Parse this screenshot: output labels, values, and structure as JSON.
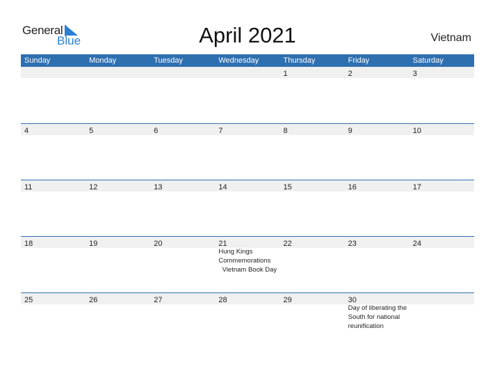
{
  "logo": {
    "line1": "General",
    "line2": "Blue"
  },
  "title": "April 2021",
  "country": "Vietnam",
  "colors": {
    "header_bg": "#2e6fb0",
    "row_bg": "#f0f0f0",
    "logo_blue": "#2a7fd4"
  },
  "weekdays": [
    "Sunday",
    "Monday",
    "Tuesday",
    "Wednesday",
    "Thursday",
    "Friday",
    "Saturday"
  ],
  "weeks": [
    {
      "days": [
        "",
        "",
        "",
        "",
        "1",
        "2",
        "3"
      ],
      "events": [
        "",
        "",
        "",
        "",
        "",
        "",
        ""
      ]
    },
    {
      "days": [
        "4",
        "5",
        "6",
        "7",
        "8",
        "9",
        "10"
      ],
      "events": [
        "",
        "",
        "",
        "",
        "",
        "",
        ""
      ]
    },
    {
      "days": [
        "11",
        "12",
        "13",
        "14",
        "15",
        "16",
        "17"
      ],
      "events": [
        "",
        "",
        "",
        "",
        "",
        "",
        ""
      ]
    },
    {
      "days": [
        "18",
        "19",
        "20",
        "21",
        "22",
        "23",
        "24"
      ],
      "events": [
        "",
        "",
        "",
        "Hung Kings Commemorations\n  Vietnam Book Day",
        "",
        "",
        ""
      ]
    },
    {
      "days": [
        "25",
        "26",
        "27",
        "28",
        "29",
        "30",
        ""
      ],
      "events": [
        "",
        "",
        "",
        "",
        "",
        "Day of liberating the South for national reunification",
        ""
      ]
    }
  ]
}
